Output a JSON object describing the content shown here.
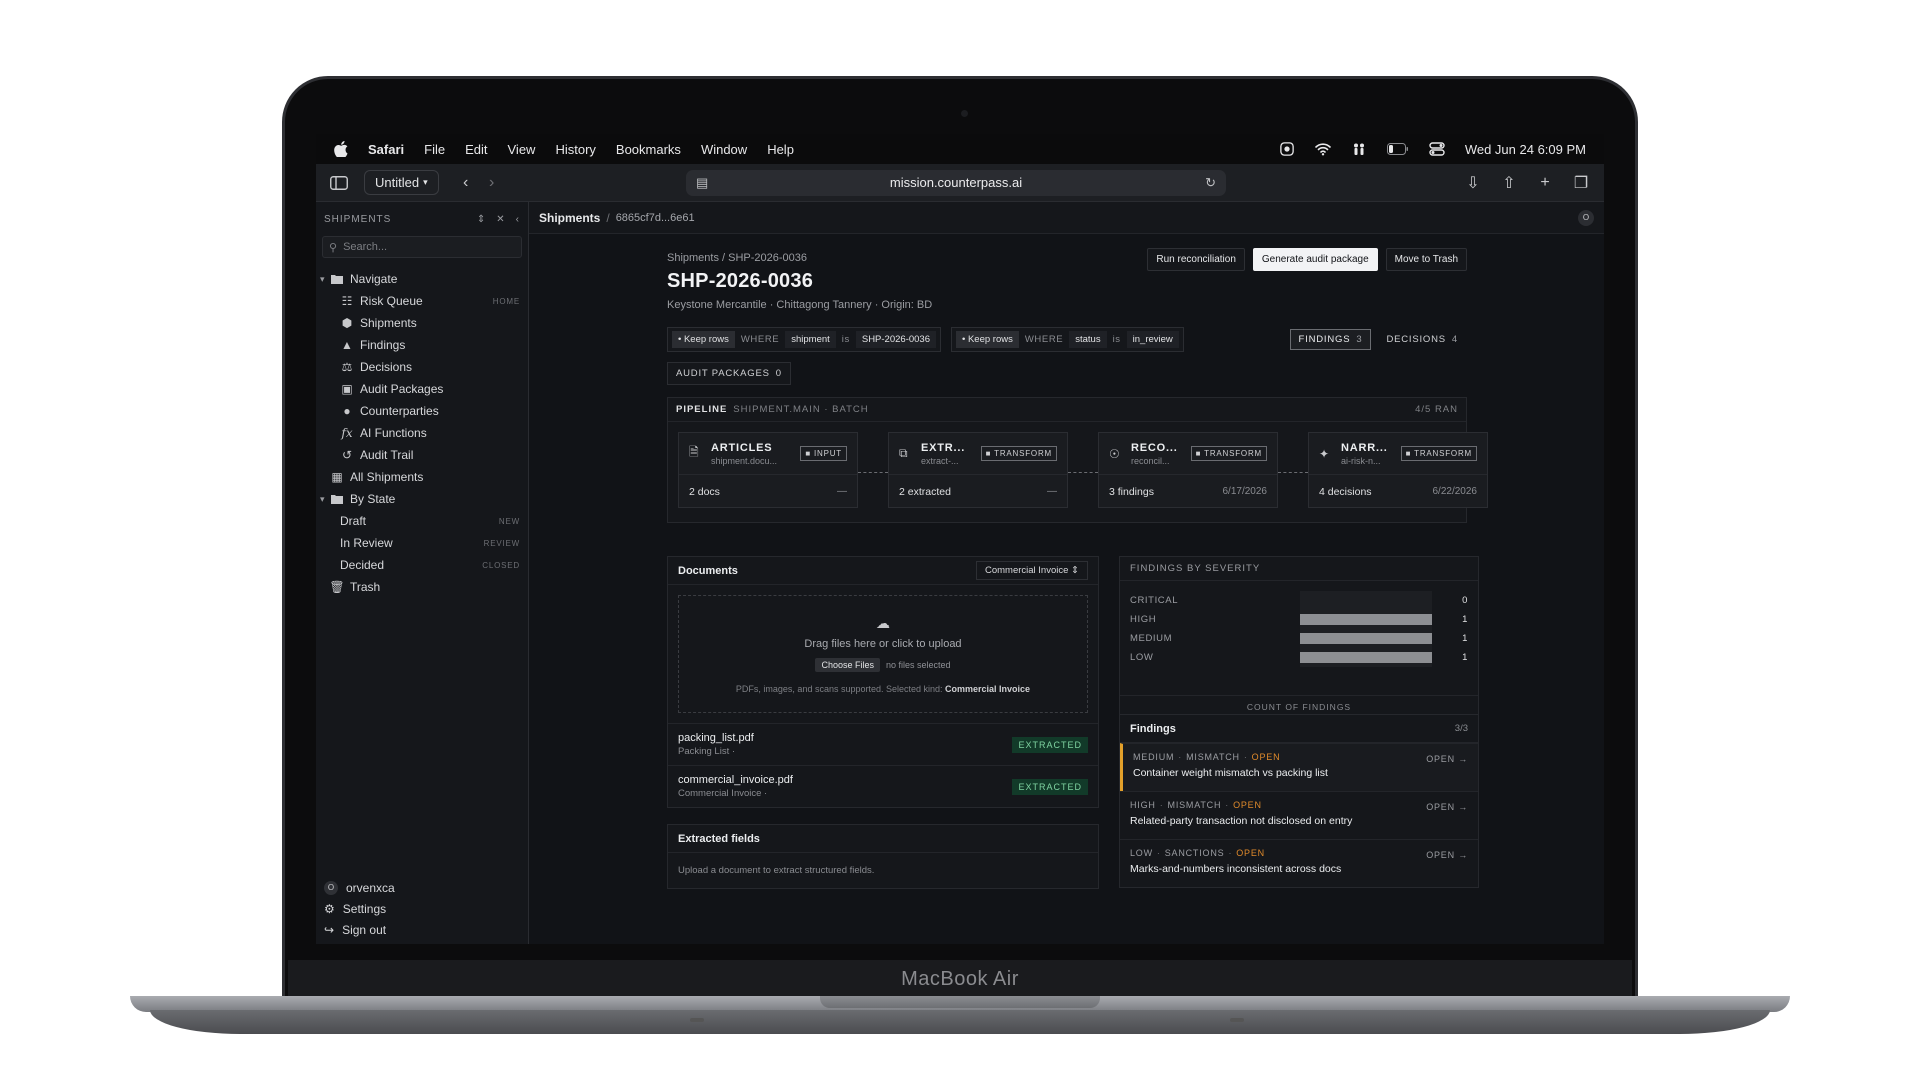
{
  "device": {
    "model": "MacBook Air"
  },
  "menubar": {
    "items": [
      "Safari",
      "File",
      "Edit",
      "View",
      "History",
      "Bookmarks",
      "Window",
      "Help"
    ],
    "clock": "Wed Jun 24  6:09 PM"
  },
  "browser": {
    "tab_title": "Untitled",
    "url": "mission.counterpass.ai"
  },
  "sidebar": {
    "header": "SHIPMENTS",
    "search_placeholder": "Search...",
    "navigate_label": "Navigate",
    "nav_items": [
      {
        "label": "Risk Queue",
        "hint": "HOME",
        "icon": "queue-icon"
      },
      {
        "label": "Shipments",
        "hint": "",
        "icon": "box-icon"
      },
      {
        "label": "Findings",
        "hint": "",
        "icon": "warning-icon"
      },
      {
        "label": "Decisions",
        "hint": "",
        "icon": "gavel-icon"
      },
      {
        "label": "Audit Packages",
        "hint": "",
        "icon": "package-icon"
      },
      {
        "label": "Counterparties",
        "hint": "",
        "icon": "people-icon"
      },
      {
        "label": "AI Functions",
        "hint": "",
        "icon": "function-icon"
      },
      {
        "label": "Audit Trail",
        "hint": "",
        "icon": "history-icon"
      }
    ],
    "all_shipments": "All Shipments",
    "by_state_label": "By State",
    "states": [
      {
        "label": "Draft",
        "hint": "NEW"
      },
      {
        "label": "In Review",
        "hint": "REVIEW"
      },
      {
        "label": "Decided",
        "hint": "CLOSED"
      }
    ],
    "trash": "Trash",
    "user": {
      "initial": "O",
      "name": "orvenxca"
    },
    "settings": "Settings",
    "sign_out": "Sign out"
  },
  "crumbbar": {
    "section": "Shipments",
    "id": "6865cf7d...6e61",
    "avatar": "O"
  },
  "page": {
    "breadcrumb": "Shipments / SHP-2026-0036",
    "title": "SHP-2026-0036",
    "subtitle": "Keystone Mercantile · Chittagong Tannery · Origin: BD",
    "actions": {
      "run": "Run reconciliation",
      "generate": "Generate audit package",
      "trash": "Move to Trash"
    }
  },
  "filters": [
    {
      "chip": "• Keep rows",
      "where": "WHERE",
      "field": "shipment",
      "is": "is",
      "value": "SHP-2026-0036"
    },
    {
      "chip": "• Keep rows",
      "where": "WHERE",
      "field": "status",
      "is": "is",
      "value": "in_review"
    }
  ],
  "tabs": {
    "findings": {
      "label": "FINDINGS",
      "count": "3"
    },
    "decisions": {
      "label": "DECISIONS",
      "count": "4"
    },
    "audit_packages": {
      "label": "AUDIT PACKAGES",
      "count": "0"
    }
  },
  "pipeline": {
    "label": "PIPELINE",
    "sub": "SHIPMENT.MAIN · BATCH",
    "ran": "4/5 RAN",
    "stages": [
      {
        "name": "ARTICLES",
        "source": "shipment.docu...",
        "kind": "■ INPUT",
        "stat": "2 docs",
        "date": "—",
        "icon": "document-icon"
      },
      {
        "name": "EXTR...",
        "source": "extract-...",
        "kind": "■ TRANSFORM",
        "stat": "2 extracted",
        "date": "—",
        "icon": "copy-icon"
      },
      {
        "name": "RECO...",
        "source": "reconcil...",
        "kind": "■ TRANSFORM",
        "stat": "3 findings",
        "date": "6/17/2026",
        "icon": "hierarchy-icon"
      },
      {
        "name": "NARR...",
        "source": "ai-risk-n...",
        "kind": "■ TRANSFORM",
        "stat": "4 decisions",
        "date": "6/22/2026",
        "icon": "sparkle-icon"
      }
    ]
  },
  "documents": {
    "title": "Documents",
    "kind_select": "Commercial Invoice",
    "drop_text": "Drag files here or click to upload",
    "choose_files": "Choose Files",
    "no_files": "no files selected",
    "note_prefix": "PDFs, images, and scans supported. Selected kind: ",
    "note_kind": "Commercial Invoice",
    "files": [
      {
        "name": "packing_list.pdf",
        "type": "Packing List ·",
        "status": "EXTRACTED"
      },
      {
        "name": "commercial_invoice.pdf",
        "type": "Commercial Invoice ·",
        "status": "EXTRACTED"
      }
    ]
  },
  "extracted": {
    "title": "Extracted fields",
    "empty": "Upload a document to extract structured fields."
  },
  "severity": {
    "title": "FINDINGS BY SEVERITY",
    "footer": "COUNT OF FINDINGS",
    "rows": [
      {
        "label": "CRITICAL",
        "count": 0
      },
      {
        "label": "HIGH",
        "count": 1
      },
      {
        "label": "MEDIUM",
        "count": 1
      },
      {
        "label": "LOW",
        "count": 1
      }
    ],
    "bar_color": "#8d8f93"
  },
  "findings": {
    "title": "Findings",
    "count": "3/3",
    "items": [
      {
        "severity": "MEDIUM",
        "type": "MISMATCH",
        "status": "OPEN",
        "title": "Container weight mismatch vs packing list",
        "action": "OPEN →"
      },
      {
        "severity": "HIGH",
        "type": "MISMATCH",
        "status": "OPEN",
        "title": "Related-party transaction not disclosed on entry",
        "action": "OPEN →"
      },
      {
        "severity": "LOW",
        "type": "SANCTIONS",
        "status": "OPEN",
        "title": "Marks-and-numbers inconsistent across docs",
        "action": "OPEN →"
      }
    ],
    "accent_color": "#e3a02a",
    "open_color": "#e08a2b"
  }
}
